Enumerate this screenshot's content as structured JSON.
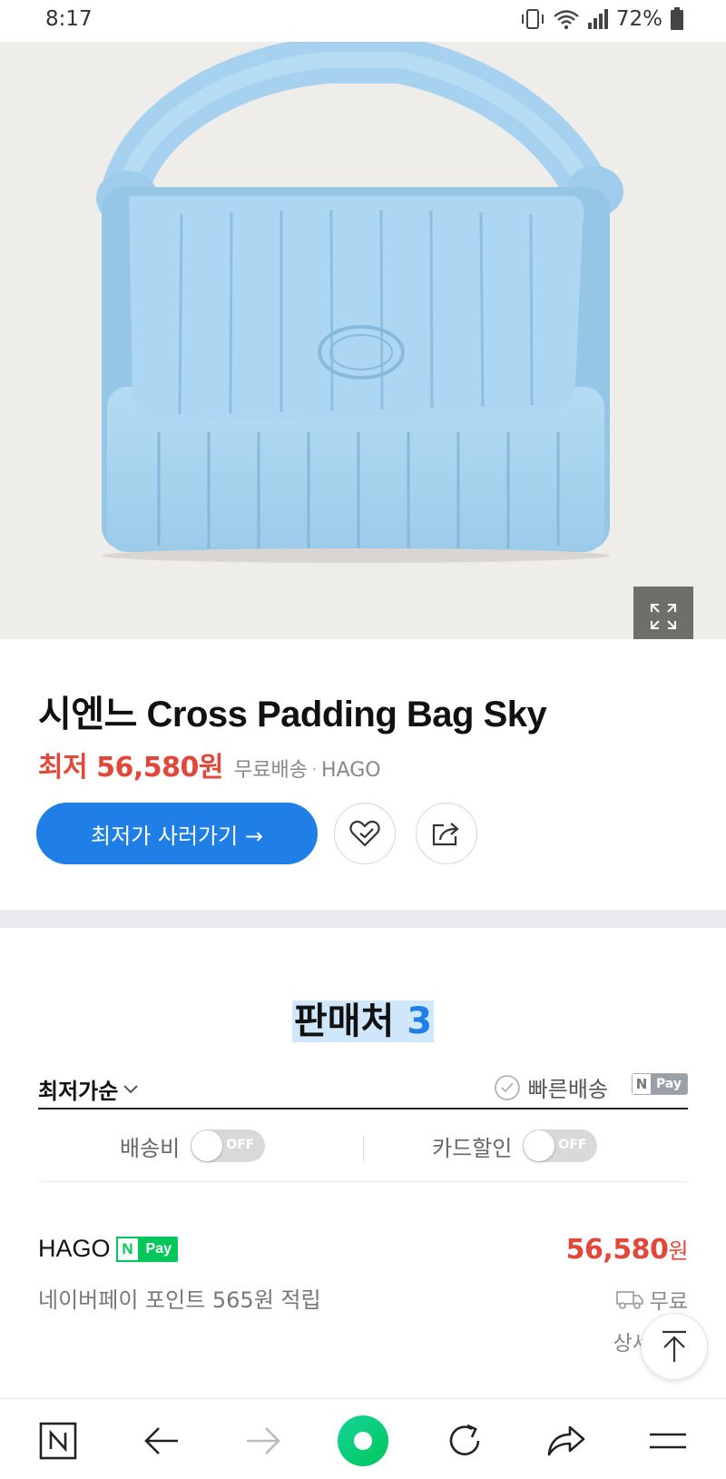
{
  "status_bar": {
    "time": "8:17",
    "battery": "72%",
    "icons": [
      "vibrate-icon",
      "wifi-icon",
      "signal-icon",
      "battery-icon"
    ]
  },
  "hero": {
    "image_alt": "Sky blue quilted padding bag with knotted handle",
    "expand_icon": "expand-icon"
  },
  "product": {
    "title": "시엔느 Cross Padding Bag Sky",
    "price_lowest": "최저 56,580원",
    "shipping": "무료배송",
    "seller": "HAGO",
    "buy_button": "최저가 사러가기 →",
    "wishlist_icon": "heart-icon",
    "share_icon": "share-icon"
  },
  "sellers": {
    "title_label": "판매처",
    "title_count": "3",
    "sort_label": "최저가순",
    "fast_shipping": "빠른배송",
    "npay_filter": "Pay",
    "npay_filter_n": "N",
    "filters": {
      "shipping_label": "배송비",
      "shipping_toggle": "OFF",
      "card_label": "카드할인",
      "card_toggle": "OFF"
    },
    "rows": [
      {
        "name": "HAGO",
        "npay_n": "N",
        "npay_label": "Pay",
        "point": "네이버페이 포인트 565원 적립",
        "price": "56,580",
        "price_unit": "원",
        "shipping": "무료",
        "extra": "상세"
      }
    ]
  },
  "colors": {
    "accent": "#1f7fe6",
    "price": "#e1483a",
    "npay": "#03c75a",
    "hero_bg": "#efedea",
    "bag": "#a9d3ee"
  },
  "bottom_nav": {
    "items": [
      "naver-home-icon",
      "back-icon",
      "forward-icon",
      "green-dot-icon",
      "refresh-icon",
      "share-arrow-icon",
      "menu-icon"
    ]
  }
}
